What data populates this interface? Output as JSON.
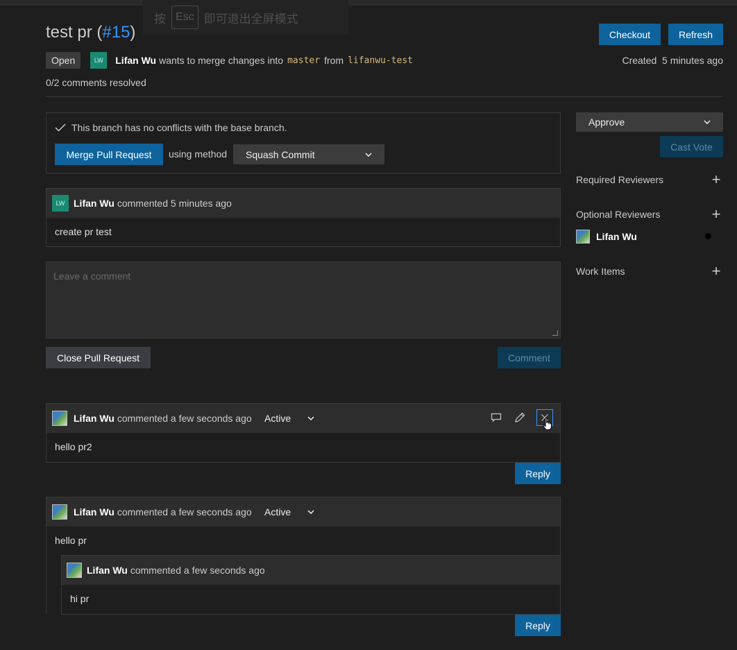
{
  "fullscreen_hint": {
    "prefix": "按",
    "key": "Esc",
    "suffix": "即可退出全屏模式"
  },
  "pr": {
    "title": "test pr",
    "number_open": "(",
    "number": "#15",
    "number_close": ")"
  },
  "header": {
    "checkout_label": "Checkout",
    "refresh_label": "Refresh"
  },
  "meta": {
    "status": "Open",
    "avatar_initials": "LW",
    "author": "Lifan Wu",
    "text_wants": "wants to merge changes",
    "text_into": "into",
    "target_branch": "master",
    "text_from": "from",
    "source_branch": "lifanwu-test",
    "created_label": "Created",
    "created_time": "5 minutes ago",
    "resolved": "0/2 comments resolved"
  },
  "merge": {
    "check_icon": "check-icon",
    "no_conflicts": "This branch has no conflicts with the base branch.",
    "merge_label": "Merge Pull Request",
    "using_method": "using method",
    "method": "Squash Commit"
  },
  "description": {
    "author": "Lifan Wu",
    "avatar_initials": "LW",
    "commented": "commented",
    "time": "5 minutes ago",
    "body": "create pr test"
  },
  "new_comment": {
    "placeholder": "Leave a comment",
    "close_label": "Close Pull Request",
    "comment_label": "Comment"
  },
  "threads": [
    {
      "author": "Lifan Wu",
      "commented": "commented",
      "time": "a few seconds ago",
      "status": "Active",
      "body": "hello pr2",
      "reply_label": "Reply",
      "icons": [
        "comment-icon",
        "edit-icon",
        "close-icon"
      ]
    },
    {
      "author": "Lifan Wu",
      "commented": "commented",
      "time": "a few seconds ago",
      "status": "Active",
      "body": "hello pr",
      "reply_label": "Reply",
      "reply": {
        "author": "Lifan Wu",
        "commented": "commented",
        "time": "a few seconds ago",
        "body": "hi pr"
      }
    }
  ],
  "sidebar": {
    "vote_option": "Approve",
    "cast_vote_label": "Cast Vote",
    "required_reviewers": "Required Reviewers",
    "optional_reviewers": "Optional Reviewers",
    "reviewer_name": "Lifan Wu",
    "work_items": "Work Items"
  },
  "colors": {
    "accent": "#0e639c",
    "link": "#3794ff",
    "background": "#1e1e1e",
    "panel": "#2d2d2d",
    "branch": "#d7ba7d",
    "avatar": "#1b8a73"
  }
}
